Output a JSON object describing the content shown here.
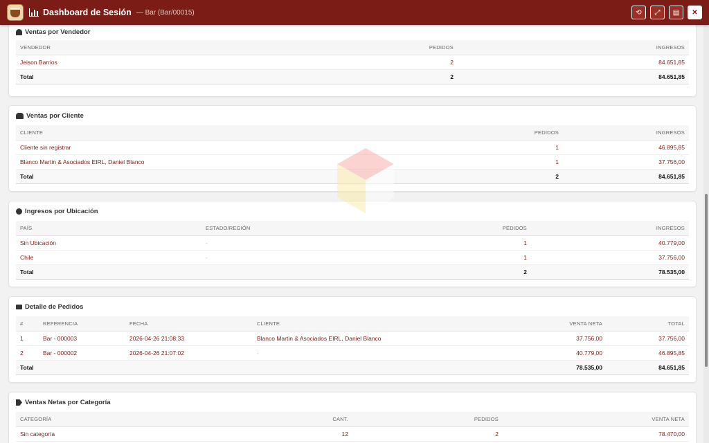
{
  "window": {
    "title": "Dashboard de Sesión",
    "subtitle": "— Bar (Bar/00015)",
    "buttons": {
      "refresh_icon": "⟲",
      "expand_icon": "⤢",
      "pdf_icon": "▤",
      "close_icon": "✕"
    }
  },
  "vendedor": {
    "title": "Ventas por Vendedor",
    "headers": [
      "VENDEDOR",
      "PEDIDOS",
      "INGRESOS"
    ],
    "rows": [
      {
        "name": "Jeison Barrios",
        "pedidos": "2",
        "ingresos": "84.651,85"
      }
    ],
    "total": {
      "label": "Total",
      "pedidos": "2",
      "ingresos": "84.651,85"
    }
  },
  "cliente": {
    "title": "Ventas por Cliente",
    "headers": [
      "CLIENTE",
      "PEDIDOS",
      "INGRESOS"
    ],
    "rows": [
      {
        "name": "Cliente sin registrar",
        "pedidos": "1",
        "ingresos": "46.895,85"
      },
      {
        "name": "Blanco Martin & Asociados EIRL, Daniel Blanco",
        "pedidos": "1",
        "ingresos": "37.756,00"
      }
    ],
    "total": {
      "label": "Total",
      "pedidos": "2",
      "ingresos": "84.651,85"
    }
  },
  "ubicacion": {
    "title": "Ingresos por Ubicación",
    "headers": [
      "PAÍS",
      "ESTADO/REGIÓN",
      "PEDIDOS",
      "INGRESOS"
    ],
    "rows": [
      {
        "pais": "Sin Ubicación",
        "estado": "-",
        "pedidos": "1",
        "ingresos": "40.779,00"
      },
      {
        "pais": "Chile",
        "estado": "-",
        "pedidos": "1",
        "ingresos": "37.756,00"
      }
    ],
    "total": {
      "label": "Total",
      "pedidos": "2",
      "ingresos": "78.535,00"
    }
  },
  "pedidos": {
    "title": "Detalle de Pedidos",
    "headers": [
      "#",
      "REFERENCIA",
      "FECHA",
      "CLIENTE",
      "VENTA NETA",
      "TOTAL"
    ],
    "rows": [
      {
        "num": "1",
        "ref": "Bar - 000003",
        "fecha": "2026-04-26 21:08:33",
        "cliente": "Blanco Martin & Asociados EIRL, Daniel Blanco",
        "neta": "37.756,00",
        "total": "37.756,00"
      },
      {
        "num": "2",
        "ref": "Bar - 000002",
        "fecha": "2026-04-26 21:07:02",
        "cliente": "-",
        "neta": "40.779,00",
        "total": "46.895,85"
      }
    ],
    "total": {
      "label": "Total",
      "neta": "78.535,00",
      "total": "84.651,85"
    }
  },
  "categoria": {
    "title": "Ventas Netas por Categoría",
    "headers": [
      "CATEGORÍA",
      "CANT.",
      "PEDIDOS",
      "VENTA NETA"
    ],
    "rows": [
      {
        "name": "Sin categoría",
        "cant": "12",
        "pedidos": "2",
        "neta": "78.470,00"
      }
    ]
  }
}
